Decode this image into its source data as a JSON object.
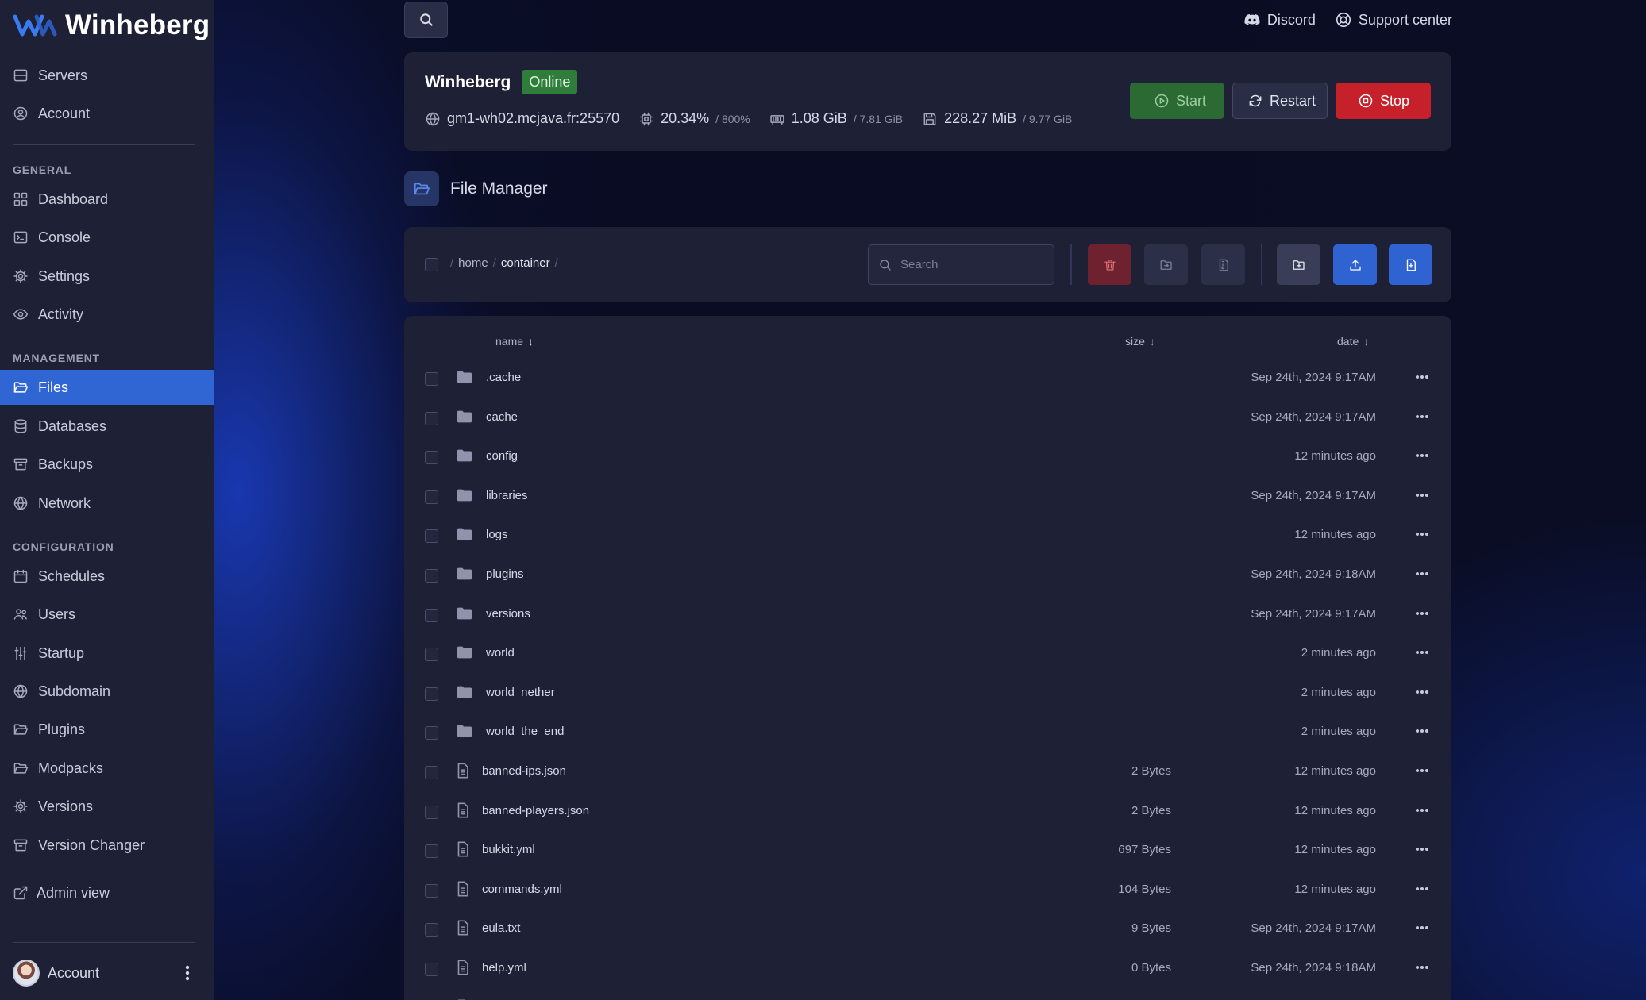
{
  "brand": {
    "name": "Winheberg",
    "accent": "#3066d4"
  },
  "sidebar": {
    "top_items": [
      {
        "label": "Servers",
        "icon": "server-icon"
      },
      {
        "label": "Account",
        "icon": "user-circle-icon"
      }
    ],
    "sections": [
      {
        "title": "GENERAL",
        "items": [
          {
            "label": "Dashboard",
            "icon": "grid-icon"
          },
          {
            "label": "Console",
            "icon": "terminal-icon"
          },
          {
            "label": "Settings",
            "icon": "gear-icon"
          },
          {
            "label": "Activity",
            "icon": "eye-icon"
          }
        ]
      },
      {
        "title": "MANAGEMENT",
        "items": [
          {
            "label": "Files",
            "icon": "folder-open-icon",
            "active": true
          },
          {
            "label": "Databases",
            "icon": "database-icon"
          },
          {
            "label": "Backups",
            "icon": "archive-icon"
          },
          {
            "label": "Network",
            "icon": "globe-icon"
          }
        ]
      },
      {
        "title": "CONFIGURATION",
        "items": [
          {
            "label": "Schedules",
            "icon": "calendar-icon"
          },
          {
            "label": "Users",
            "icon": "users-icon"
          },
          {
            "label": "Startup",
            "icon": "sliders-icon"
          },
          {
            "label": "Subdomain",
            "icon": "globe-icon"
          },
          {
            "label": "Plugins",
            "icon": "folder-open-icon"
          },
          {
            "label": "Modpacks",
            "icon": "folder-open-icon"
          },
          {
            "label": "Versions",
            "icon": "gear-icon"
          },
          {
            "label": "Version Changer",
            "icon": "archive-icon"
          }
        ]
      }
    ],
    "admin_view": "Admin view",
    "account_label": "Account"
  },
  "topbar": {
    "links": [
      {
        "label": "Discord",
        "icon": "discord-icon"
      },
      {
        "label": "Support center",
        "icon": "lifebuoy-icon"
      }
    ]
  },
  "server": {
    "name": "Winheberg",
    "status": "Online",
    "address": "gm1-wh02.mcjava.fr:25570",
    "cpu": "20.34%",
    "cpu_limit": "/ 800%",
    "memory": "1.08 GiB",
    "memory_limit": "/ 7.81 GiB",
    "disk": "228.27 MiB",
    "disk_limit": "/ 9.77 GiB",
    "actions": {
      "start": "Start",
      "restart": "Restart",
      "stop": "Stop"
    },
    "colors": {
      "online": "#2f7d3b",
      "start": "#2b6a33",
      "stop": "#c6212b"
    }
  },
  "file_manager": {
    "title": "File Manager",
    "breadcrumb": [
      "home",
      "container"
    ],
    "search_placeholder": "Search",
    "columns": {
      "name": "name",
      "size": "size",
      "date": "date"
    },
    "sort_arrow": "↓",
    "files": [
      {
        "name": ".cache",
        "type": "folder",
        "size": "",
        "date": "Sep 24th, 2024 9:17AM"
      },
      {
        "name": "cache",
        "type": "folder",
        "size": "",
        "date": "Sep 24th, 2024 9:17AM"
      },
      {
        "name": "config",
        "type": "folder",
        "size": "",
        "date": "12 minutes ago"
      },
      {
        "name": "libraries",
        "type": "folder",
        "size": "",
        "date": "Sep 24th, 2024 9:17AM"
      },
      {
        "name": "logs",
        "type": "folder",
        "size": "",
        "date": "12 minutes ago"
      },
      {
        "name": "plugins",
        "type": "folder",
        "size": "",
        "date": "Sep 24th, 2024 9:18AM"
      },
      {
        "name": "versions",
        "type": "folder",
        "size": "",
        "date": "Sep 24th, 2024 9:17AM"
      },
      {
        "name": "world",
        "type": "folder",
        "size": "",
        "date": "2 minutes ago"
      },
      {
        "name": "world_nether",
        "type": "folder",
        "size": "",
        "date": "2 minutes ago"
      },
      {
        "name": "world_the_end",
        "type": "folder",
        "size": "",
        "date": "2 minutes ago"
      },
      {
        "name": "banned-ips.json",
        "type": "file",
        "size": "2 Bytes",
        "date": "12 minutes ago"
      },
      {
        "name": "banned-players.json",
        "type": "file",
        "size": "2 Bytes",
        "date": "12 minutes ago"
      },
      {
        "name": "bukkit.yml",
        "type": "file",
        "size": "697 Bytes",
        "date": "12 minutes ago"
      },
      {
        "name": "commands.yml",
        "type": "file",
        "size": "104 Bytes",
        "date": "12 minutes ago"
      },
      {
        "name": "eula.txt",
        "type": "file",
        "size": "9 Bytes",
        "date": "Sep 24th, 2024 9:17AM"
      },
      {
        "name": "help.yml",
        "type": "file",
        "size": "0 Bytes",
        "date": "Sep 24th, 2024 9:18AM"
      },
      {
        "name": "",
        "type": "file",
        "size": "",
        "date": ""
      }
    ]
  }
}
